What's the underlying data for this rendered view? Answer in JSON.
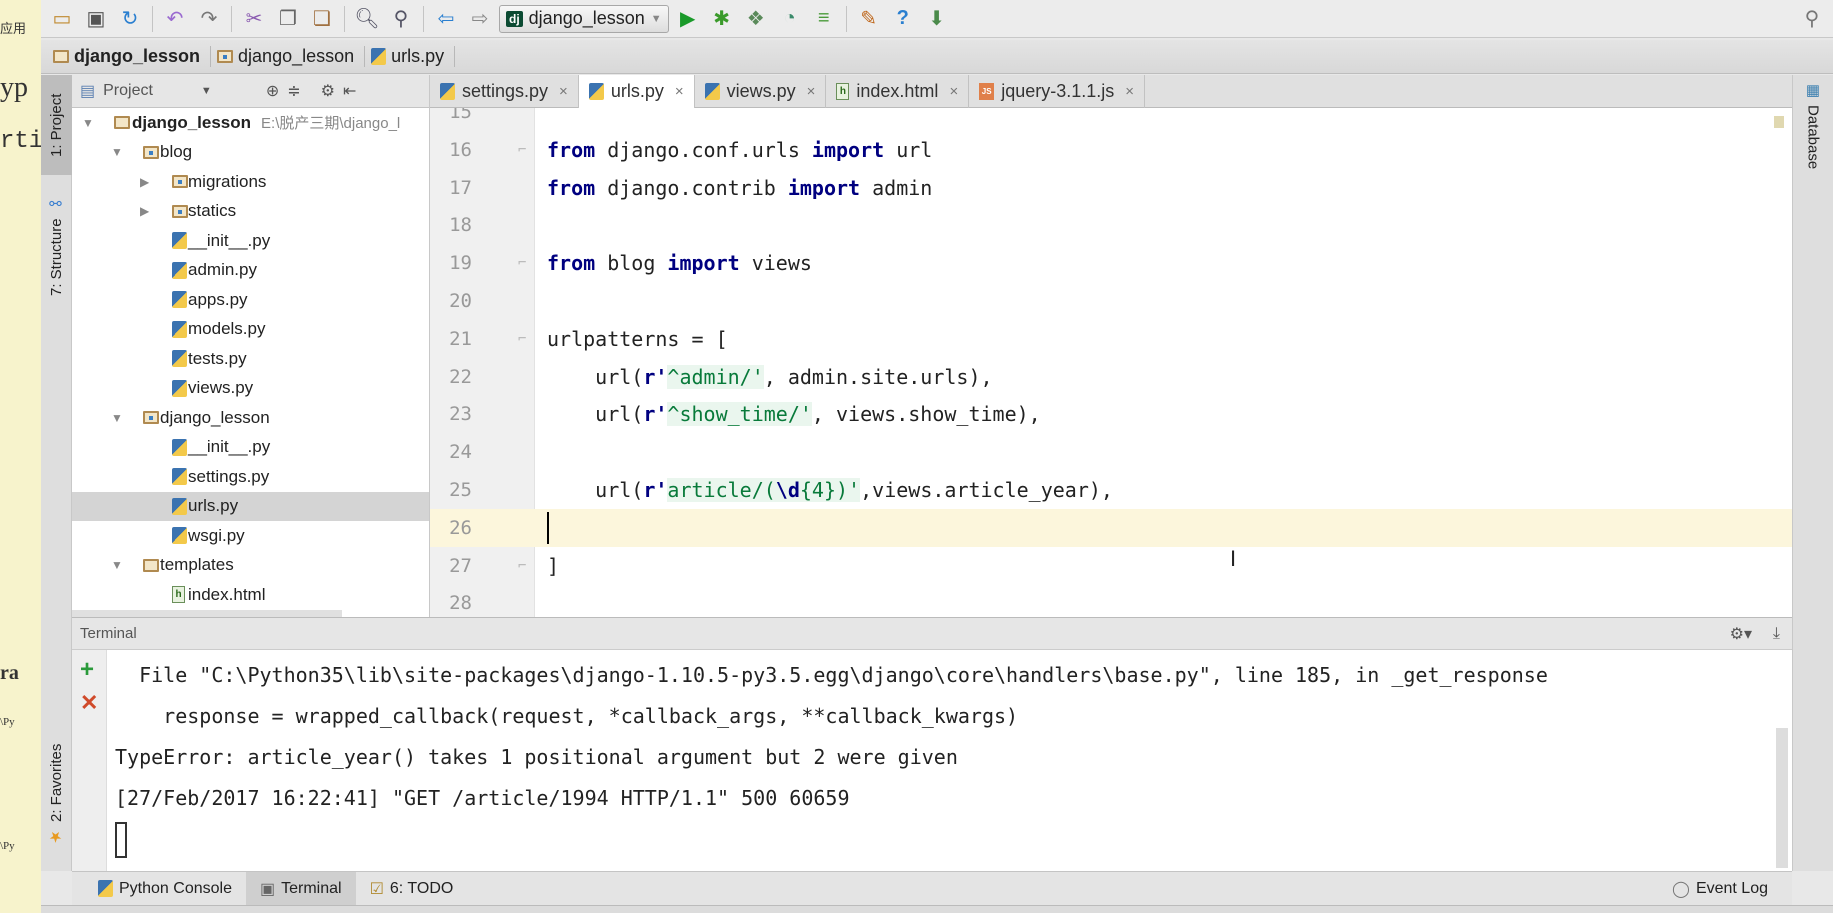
{
  "desktop_fragments": [
    "应用",
    "yp",
    "rti",
    "ra",
    "\\Py",
    "\\Py"
  ],
  "toolbar": {
    "run_config": "django_lesson",
    "icons": [
      "open-folder",
      "save",
      "sync",
      "undo",
      "redo",
      "cut",
      "copy",
      "paste",
      "find",
      "replace",
      "back",
      "forward",
      "run",
      "debug",
      "coverage",
      "profile",
      "concurrency",
      "settings",
      "help",
      "sdk-manager",
      "search"
    ]
  },
  "breadcrumb": [
    "django_lesson",
    "django_lesson",
    "urls.py"
  ],
  "left_tools": {
    "project": "1: Project",
    "structure": "7: Structure",
    "favorites": "2: Favorites"
  },
  "right_tools": {
    "database": "Database"
  },
  "project_panel": {
    "title": "Project",
    "tree": [
      {
        "label": "django_lesson",
        "path": "E:\\脱产三期\\django_l",
        "level": 0,
        "type": "folder",
        "expanded": true,
        "bold": true
      },
      {
        "label": "blog",
        "level": 1,
        "type": "module",
        "expanded": true
      },
      {
        "label": "migrations",
        "level": 2,
        "type": "module",
        "expanded": false
      },
      {
        "label": "statics",
        "level": 2,
        "type": "module",
        "expanded": false
      },
      {
        "label": "__init__.py",
        "level": 2,
        "type": "py"
      },
      {
        "label": "admin.py",
        "level": 2,
        "type": "py"
      },
      {
        "label": "apps.py",
        "level": 2,
        "type": "py"
      },
      {
        "label": "models.py",
        "level": 2,
        "type": "py"
      },
      {
        "label": "tests.py",
        "level": 2,
        "type": "py"
      },
      {
        "label": "views.py",
        "level": 2,
        "type": "py"
      },
      {
        "label": "django_lesson",
        "level": 1,
        "type": "module",
        "expanded": true
      },
      {
        "label": "__init__.py",
        "level": 2,
        "type": "py"
      },
      {
        "label": "settings.py",
        "level": 2,
        "type": "py"
      },
      {
        "label": "urls.py",
        "level": 2,
        "type": "py",
        "selected": true
      },
      {
        "label": "wsgi.py",
        "level": 2,
        "type": "py"
      },
      {
        "label": "templates",
        "level": 1,
        "type": "folder",
        "expanded": true
      },
      {
        "label": "index.html",
        "level": 2,
        "type": "html"
      }
    ]
  },
  "tabs": [
    {
      "label": "settings.py",
      "type": "py"
    },
    {
      "label": "urls.py",
      "type": "py",
      "active": true
    },
    {
      "label": "views.py",
      "type": "py"
    },
    {
      "label": "index.html",
      "type": "html"
    },
    {
      "label": "jquery-3.1.1.js",
      "type": "js"
    }
  ],
  "editor": {
    "current_line": 26,
    "lines": [
      {
        "n": "15",
        "t": []
      },
      {
        "n": "16",
        "t": [
          [
            "from",
            "kw"
          ],
          [
            " django.conf.urls ",
            ""
          ],
          [
            "import",
            "kw"
          ],
          [
            " url",
            ""
          ]
        ]
      },
      {
        "n": "17",
        "t": [
          [
            "from",
            "kw"
          ],
          [
            " django.contrib ",
            ""
          ],
          [
            "import",
            "kw"
          ],
          [
            " admin",
            ""
          ]
        ]
      },
      {
        "n": "18",
        "t": []
      },
      {
        "n": "19",
        "t": [
          [
            "from",
            "kw"
          ],
          [
            " blog ",
            ""
          ],
          [
            "import",
            "kw"
          ],
          [
            " views",
            ""
          ]
        ]
      },
      {
        "n": "20",
        "t": []
      },
      {
        "n": "21",
        "t": [
          [
            "urlpatterns = [",
            ""
          ]
        ]
      },
      {
        "n": "22",
        "t": [
          [
            "    url(",
            ""
          ],
          [
            "r'",
            "kw"
          ],
          [
            "^admin/'",
            "str"
          ],
          [
            ", admin.site.urls),",
            ""
          ]
        ]
      },
      {
        "n": "23",
        "t": [
          [
            "    url(",
            ""
          ],
          [
            "r'",
            "kw"
          ],
          [
            "^show_time/'",
            "str"
          ],
          [
            ", views.show_time),",
            ""
          ]
        ]
      },
      {
        "n": "24",
        "t": []
      },
      {
        "n": "25",
        "t": [
          [
            "    url(",
            ""
          ],
          [
            "r'",
            "kw"
          ],
          [
            "article/(",
            "str"
          ],
          [
            "\\d",
            "strb"
          ],
          [
            "{4})'",
            "str"
          ],
          [
            ",views.article_year),",
            ""
          ]
        ]
      },
      {
        "n": "26",
        "t": []
      },
      {
        "n": "27",
        "t": [
          [
            "]",
            ""
          ]
        ]
      },
      {
        "n": "28",
        "t": []
      }
    ]
  },
  "terminal": {
    "title": "Terminal",
    "lines": [
      "  File \"C:\\Python35\\lib\\site-packages\\django-1.10.5-py3.5.egg\\django\\core\\handlers\\base.py\", line 185, in _get_response",
      "    response = wrapped_callback(request, *callback_args, **callback_kwargs)",
      "TypeError: article_year() takes 1 positional argument but 2 were given",
      "[27/Feb/2017 16:22:41] \"GET /article/1994 HTTP/1.1\" 500 60659"
    ]
  },
  "bottom_tabs": {
    "python_console": "Python Console",
    "terminal": "Terminal",
    "todo": "6: TODO",
    "event_log": "Event Log"
  }
}
